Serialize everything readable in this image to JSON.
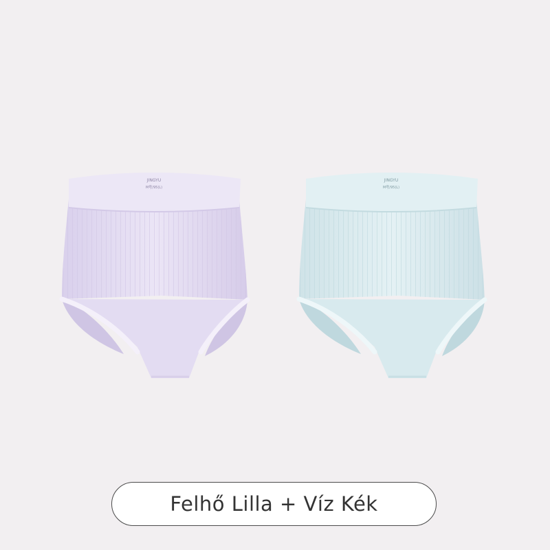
{
  "image": {
    "subject": "two high-waist briefs",
    "products": [
      {
        "color_name": "Felhő Lilla",
        "color": "#e6dff4",
        "shade": "#cfc4e6",
        "waistband_label": [
          "JINGYU",
          "M号/95(L)"
        ]
      },
      {
        "color_name": "Víz Kék",
        "color": "#dcedf0",
        "shade": "#bfd8de",
        "waistband_label": [
          "JINGYU",
          "M号/95(L)"
        ]
      }
    ]
  },
  "caption": {
    "text": "Felhő Lilla + Víz Kék"
  },
  "colors": {
    "background": "#f2eff1",
    "pill_border": "#4a4a4a",
    "pill_text": "#333333"
  }
}
